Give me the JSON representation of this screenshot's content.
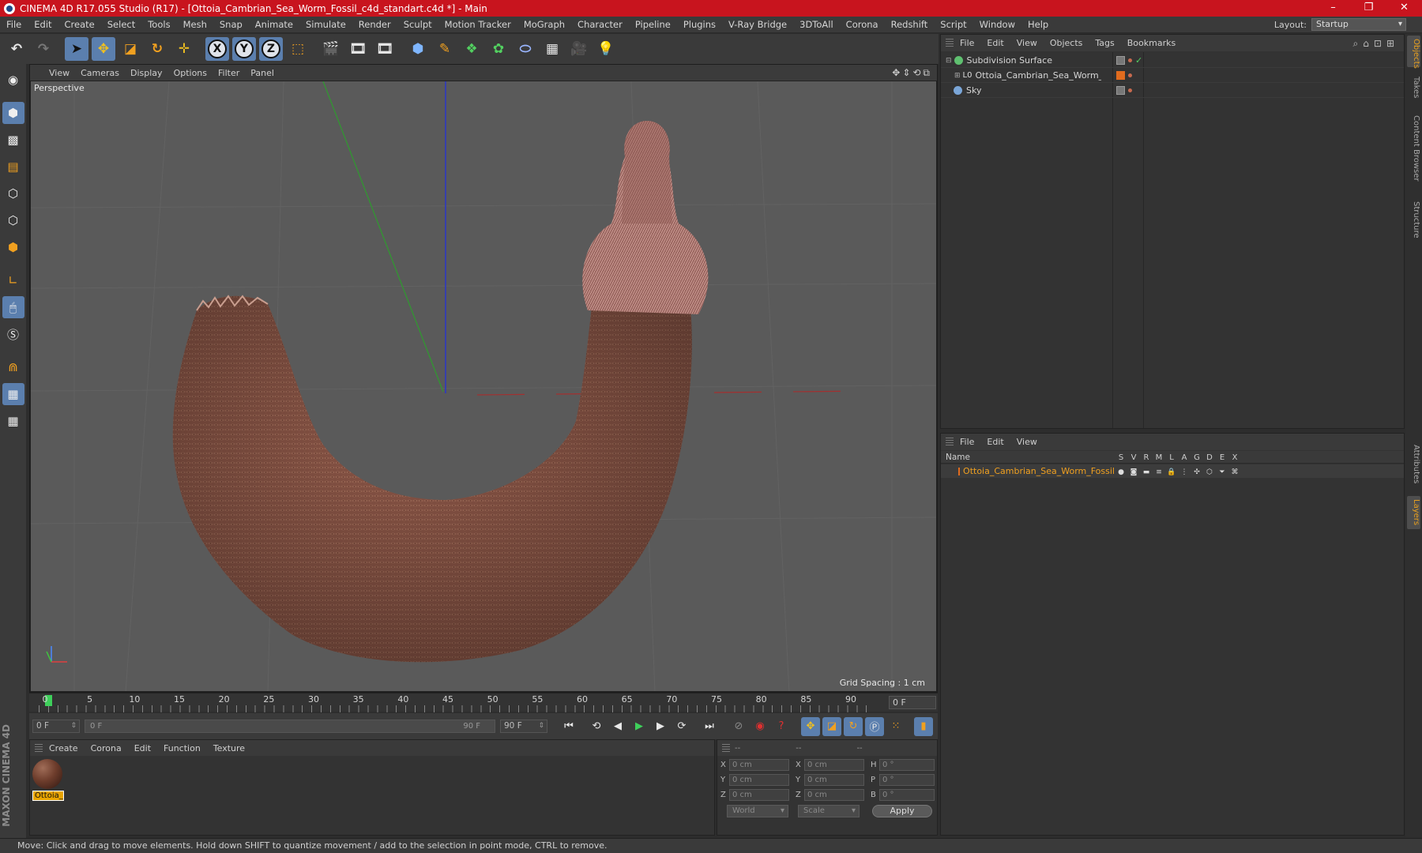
{
  "window": {
    "title": "CINEMA 4D R17.055 Studio (R17) - [Ottoia_Cambrian_Sea_Worm_Fossil_c4d_standart.c4d *] - Main",
    "controls": [
      "–",
      "❐",
      "✕"
    ]
  },
  "menubar": {
    "items": [
      "File",
      "Edit",
      "Create",
      "Select",
      "Tools",
      "Mesh",
      "Snap",
      "Animate",
      "Simulate",
      "Render",
      "Sculpt",
      "Motion Tracker",
      "MoGraph",
      "Character",
      "Pipeline",
      "Plugins",
      "V-Ray Bridge",
      "3DToAll",
      "Corona",
      "Redshift",
      "Script",
      "Window",
      "Help"
    ],
    "layout_label": "Layout:",
    "layout_value": "Startup"
  },
  "toolbar": {
    "axis_x": "X",
    "axis_y": "Y",
    "axis_z": "Z"
  },
  "viewport": {
    "menu": [
      "View",
      "Cameras",
      "Display",
      "Options",
      "Filter",
      "Panel"
    ],
    "label": "Perspective",
    "grid_spacing": "Grid Spacing : 1 cm"
  },
  "timeline": {
    "ticks": [
      "0",
      "5",
      "10",
      "15",
      "20",
      "25",
      "30",
      "35",
      "40",
      "45",
      "50",
      "55",
      "60",
      "65",
      "70",
      "75",
      "80",
      "85",
      "90"
    ],
    "current_frame": "0 F"
  },
  "transport": {
    "start_field": "0 F",
    "range_start": "0 F",
    "range_end": "90 F",
    "end_field": "90 F"
  },
  "material_manager": {
    "menu": [
      "Create",
      "Corona",
      "Edit",
      "Function",
      "Texture"
    ],
    "material_label": "Ottoia_I"
  },
  "coordinates": {
    "headers": [
      "--",
      "--",
      "--"
    ],
    "rows": [
      {
        "a": "X",
        "av": "0 cm",
        "b": "X",
        "bv": "0 cm",
        "c": "H",
        "cv": "0 °"
      },
      {
        "a": "Y",
        "av": "0 cm",
        "b": "Y",
        "bv": "0 cm",
        "c": "P",
        "cv": "0 °"
      },
      {
        "a": "Z",
        "av": "0 cm",
        "b": "Z",
        "bv": "0 cm",
        "c": "B",
        "cv": "0 °"
      }
    ],
    "world": "World",
    "scale": "Scale",
    "apply": "Apply"
  },
  "object_manager": {
    "menu": [
      "File",
      "Edit",
      "View",
      "Objects",
      "Tags",
      "Bookmarks"
    ],
    "objects": [
      {
        "name": "Subdivision Surface",
        "color": "#5fc070"
      },
      {
        "name": "Ottoia_Cambrian_Sea_Worm_Fossil",
        "color": "#9a9a9a"
      },
      {
        "name": "Sky",
        "color": "#7aa6d8"
      }
    ]
  },
  "layer_manager": {
    "menu": [
      "File",
      "Edit",
      "View"
    ],
    "col_name": "Name",
    "flags": [
      "S",
      "V",
      "R",
      "M",
      "L",
      "A",
      "G",
      "D",
      "E",
      "X"
    ],
    "layer_name": "Ottoia_Cambrian_Sea_Worm_Fossil"
  },
  "side_tabs": [
    "Objects",
    "Takes",
    "Content Browser",
    "Structure",
    "Attributes",
    "Layers"
  ],
  "status": "Move: Click and drag to move elements. Hold down SHIFT to quantize movement / add to the selection in point mode, CTRL to remove.",
  "branding": "MAXON CINEMA 4D"
}
